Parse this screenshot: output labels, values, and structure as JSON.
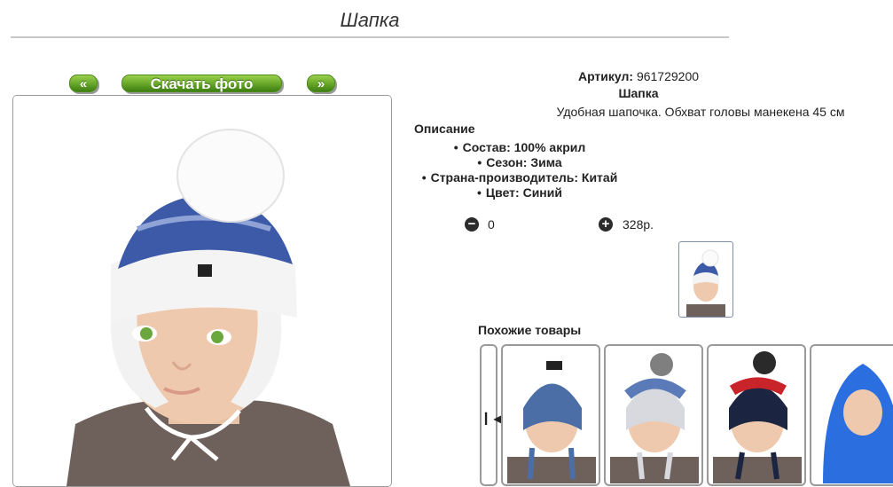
{
  "page": {
    "title": "Шапка"
  },
  "photo_nav": {
    "prev_label": "«",
    "download_label": "Скачать фото",
    "next_label": "»"
  },
  "product": {
    "articul_label": "Артикул:",
    "articul_value": "961729200",
    "name": "Шапка",
    "description": "Удобная шапочка. Обхват головы манекена 45 см",
    "description_title": "Описание",
    "attributes": [
      "Состав: 100% акрил",
      "Сезон: Зима",
      "Страна-производитель: Китай",
      "Цвет: Синий"
    ],
    "quantity": "0",
    "price": "328р."
  },
  "similar": {
    "title": "Похожие товары",
    "prev_icon": "first-page-icon",
    "items": [
      "hat-blue-earflaps",
      "hat-grey-white-pompom",
      "hat-navy-red-pompom",
      "balaclava-blue"
    ]
  },
  "colors": {
    "button_green": "#6aa92a",
    "hat_blue": "#3c5aa8",
    "hat_white": "#f4f4f4"
  }
}
